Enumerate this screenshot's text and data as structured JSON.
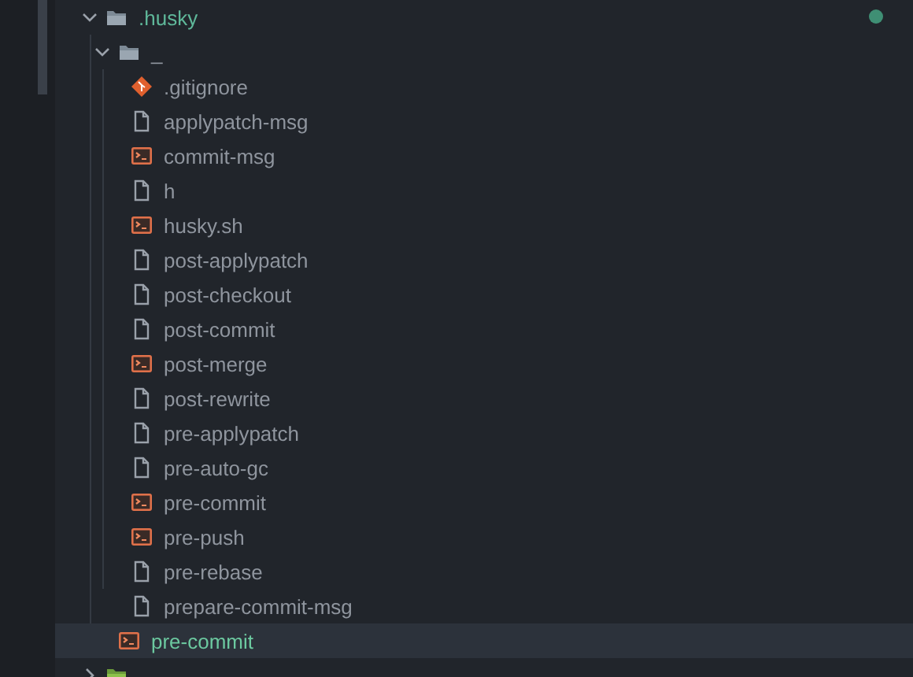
{
  "tree": [
    {
      "name": ".husky",
      "kind": "folder",
      "expanded": true,
      "selected": false,
      "modified": true,
      "children": [
        {
          "name": "_",
          "kind": "folder",
          "expanded": true,
          "selected": false,
          "children": [
            {
              "name": ".gitignore",
              "kind": "git",
              "selected": false
            },
            {
              "name": "applypatch-msg",
              "kind": "file",
              "selected": false
            },
            {
              "name": "commit-msg",
              "kind": "shell",
              "selected": false
            },
            {
              "name": "h",
              "kind": "file",
              "selected": false
            },
            {
              "name": "husky.sh",
              "kind": "shell",
              "selected": false
            },
            {
              "name": "post-applypatch",
              "kind": "file",
              "selected": false
            },
            {
              "name": "post-checkout",
              "kind": "file",
              "selected": false
            },
            {
              "name": "post-commit",
              "kind": "file",
              "selected": false
            },
            {
              "name": "post-merge",
              "kind": "shell",
              "selected": false
            },
            {
              "name": "post-rewrite",
              "kind": "file",
              "selected": false
            },
            {
              "name": "pre-applypatch",
              "kind": "file",
              "selected": false
            },
            {
              "name": "pre-auto-gc",
              "kind": "file",
              "selected": false
            },
            {
              "name": "pre-commit",
              "kind": "shell",
              "selected": false
            },
            {
              "name": "pre-push",
              "kind": "shell",
              "selected": false
            },
            {
              "name": "pre-rebase",
              "kind": "file",
              "selected": false
            },
            {
              "name": "prepare-commit-msg",
              "kind": "file",
              "selected": false
            }
          ]
        },
        {
          "name": "pre-commit",
          "kind": "shell",
          "selected": true
        }
      ]
    },
    {
      "kind": "package-folder",
      "expanded": false,
      "selected": false,
      "modified": false
    }
  ]
}
